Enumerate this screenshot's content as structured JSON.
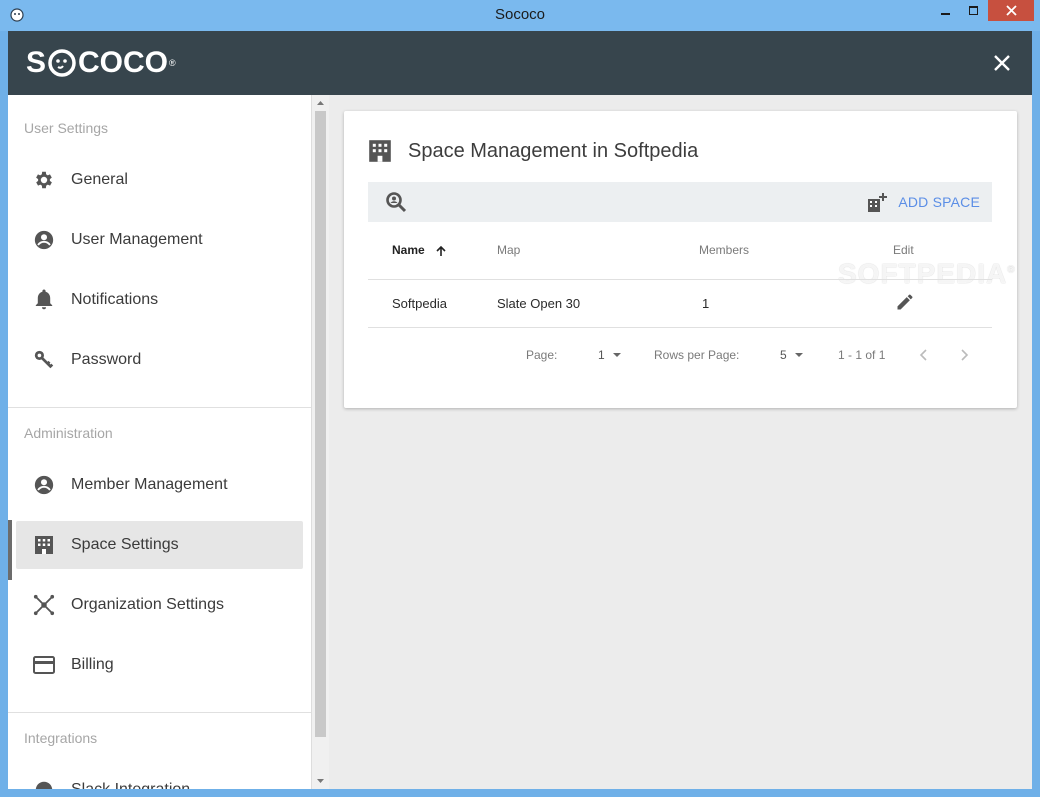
{
  "window": {
    "title": "Sococo"
  },
  "header": {
    "logo_text_left": "S",
    "logo_text_right": "COCO",
    "logo_tm": "®"
  },
  "sidebar": {
    "sections": [
      {
        "title": "User Settings",
        "items": [
          {
            "label": "General",
            "icon": "gear-icon"
          },
          {
            "label": "User Management",
            "icon": "account-circle-icon"
          },
          {
            "label": "Notifications",
            "icon": "bell-icon"
          },
          {
            "label": "Password",
            "icon": "key-icon"
          }
        ]
      },
      {
        "title": "Administration",
        "items": [
          {
            "label": "Member Management",
            "icon": "account-circle-icon"
          },
          {
            "label": "Space Settings",
            "icon": "building-icon",
            "active": true
          },
          {
            "label": "Organization Settings",
            "icon": "network-icon"
          },
          {
            "label": "Billing",
            "icon": "credit-card-icon"
          }
        ]
      },
      {
        "title": "Integrations",
        "items": [
          {
            "label": "Slack Integration",
            "icon": "slack-icon"
          }
        ]
      }
    ]
  },
  "main": {
    "card_title": "Space Management in Softpedia",
    "add_space_label": "ADD SPACE",
    "watermark": "SOFTPEDIA",
    "watermark_tm": "®",
    "table": {
      "columns": [
        "Name",
        "Map",
        "Members",
        "Edit"
      ],
      "rows": [
        {
          "name": "Softpedia",
          "map": "Slate Open 30",
          "members": "1"
        }
      ]
    },
    "pager": {
      "page_label": "Page:",
      "page_value": "1",
      "rows_label": "Rows per Page:",
      "rows_value": "5",
      "range": "1 - 1 of 1"
    }
  },
  "colors": {
    "titlebar": "#7ab9ee",
    "header": "#37454d",
    "accent": "#5b8ee6",
    "close": "#c7503f"
  }
}
